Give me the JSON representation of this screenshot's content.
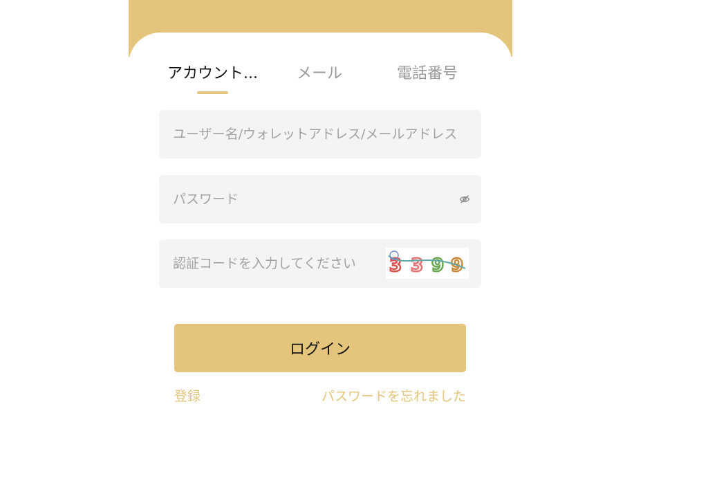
{
  "tabs": [
    {
      "label": "アカウント..."
    },
    {
      "label": "メール"
    },
    {
      "label": "電話番号"
    }
  ],
  "active_tab": "アカウント...",
  "form": {
    "username_placeholder": "ユーザー名/ウォレットアドレス/メールアドレス",
    "password_placeholder": "パスワード",
    "code_placeholder": "認証コードを入力してください",
    "captcha_text": "3399"
  },
  "login_label": "ログイン",
  "links": {
    "register": "登録",
    "forgot_password": "パスワードを忘れました"
  },
  "icons": {
    "password_toggle": "eye-slash-icon"
  },
  "colors": {
    "accent": "#e4c57b",
    "field_bg": "#f4f4f4",
    "placeholder": "#a2a2a2",
    "active_tab": "#111111",
    "inactive_tab": "#9a9a9a"
  }
}
